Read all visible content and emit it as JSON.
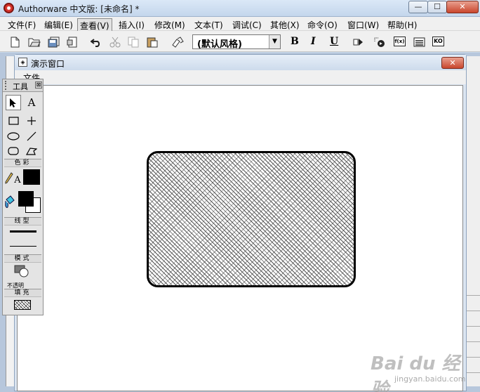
{
  "window": {
    "title": "Authorware 中文版: [未命名] *",
    "minimize_label": "—",
    "maximize_label": "☐",
    "close_label": "✕"
  },
  "menubar": {
    "items": [
      {
        "label": "文件(F)"
      },
      {
        "label": "编辑(E)"
      },
      {
        "label": "查看(V)"
      },
      {
        "label": "插入(I)"
      },
      {
        "label": "修改(M)"
      },
      {
        "label": "文本(T)"
      },
      {
        "label": "调试(C)"
      },
      {
        "label": "其他(X)"
      },
      {
        "label": "命令(O)"
      },
      {
        "label": "窗口(W)"
      },
      {
        "label": "帮助(H)"
      }
    ]
  },
  "toolbar": {
    "icons": [
      "new-file-icon",
      "open-file-icon",
      "save-all-icon",
      "import-icon",
      "undo-icon",
      "cut-icon",
      "copy-icon",
      "paste-icon",
      "find-icon"
    ],
    "style_select": "(默认风格)",
    "bold_label": "B",
    "italic_label": "I",
    "underline_label": "U",
    "fn_label": "f(x)",
    "ko_label": "KO"
  },
  "presentation": {
    "title": "演示窗口",
    "menu_label": "文件",
    "close_label": "✕"
  },
  "palette": {
    "title": "工具",
    "close_label": "⊠",
    "color_section": "色彩",
    "line_section": "线型",
    "mode_section": "模式",
    "mode_value": "不透明",
    "fill_section": "填充",
    "text_tool": "A",
    "color_text_label": "A"
  },
  "shape": {
    "type": "rounded-rectangle",
    "fill": "crosshatch-pattern",
    "stroke_color": "#000000"
  },
  "watermark": {
    "text": "Bai du 经验",
    "sub": "jingyan.baidu.com"
  }
}
